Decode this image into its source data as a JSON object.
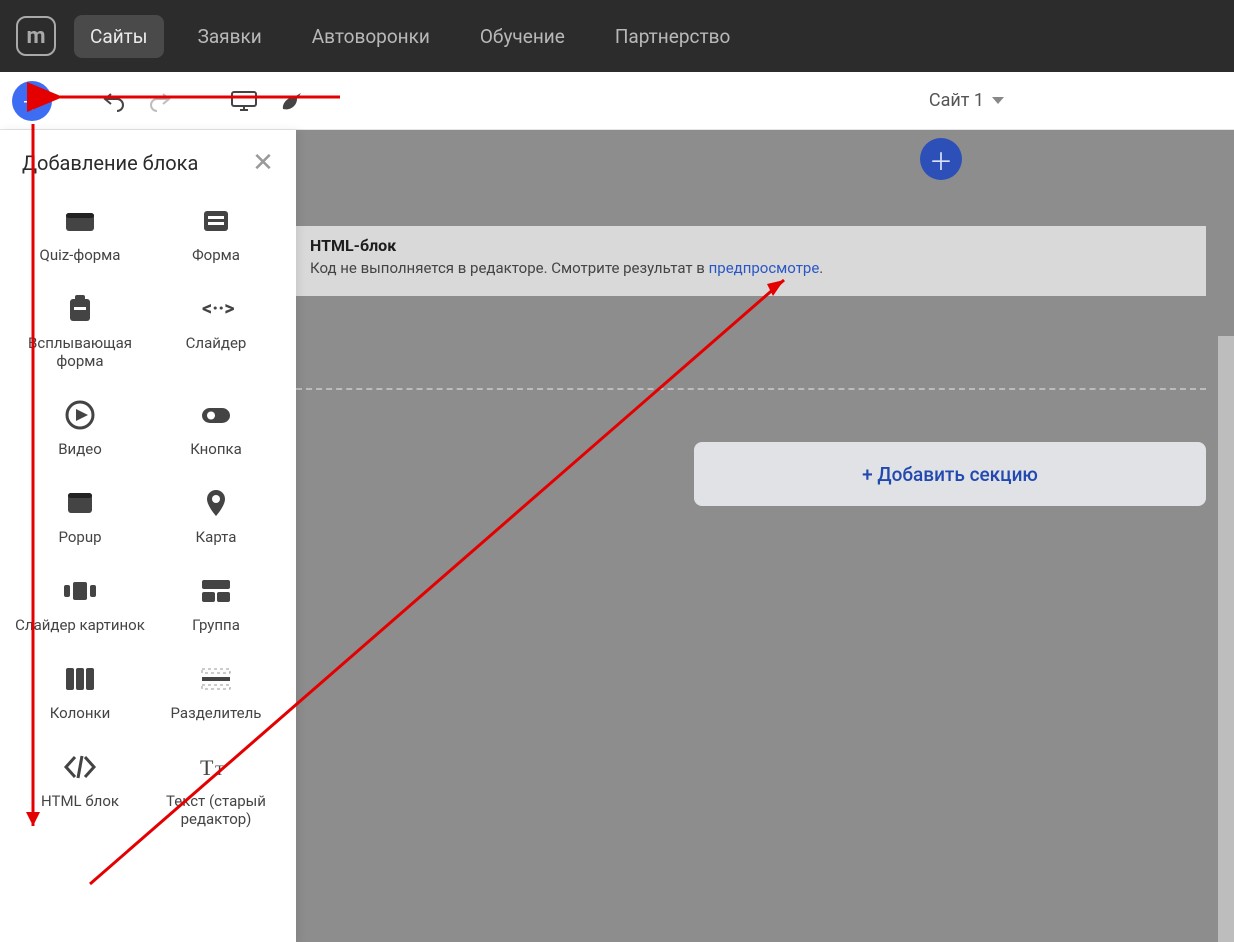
{
  "nav": {
    "items": [
      "Сайты",
      "Заявки",
      "Автоворонки",
      "Обучение",
      "Партнерство"
    ],
    "activeIndex": 0
  },
  "toolbar": {
    "siteSelector": "Сайт 1"
  },
  "panel": {
    "title": "Добавление блока",
    "blocks": [
      {
        "label": "Quiz-форма",
        "icon": "card"
      },
      {
        "label": "Форма",
        "icon": "form"
      },
      {
        "label": "Всплывающая форма",
        "icon": "clipboard"
      },
      {
        "label": "Слайдер",
        "icon": "slider"
      },
      {
        "label": "Видео",
        "icon": "play"
      },
      {
        "label": "Кнопка",
        "icon": "button"
      },
      {
        "label": "Popup",
        "icon": "popup"
      },
      {
        "label": "Карта",
        "icon": "pin"
      },
      {
        "label": "Слайдер картинок",
        "icon": "carousel"
      },
      {
        "label": "Группа",
        "icon": "group"
      },
      {
        "label": "Колонки",
        "icon": "columns"
      },
      {
        "label": "Разделитель",
        "icon": "divider"
      },
      {
        "label": "HTML блок",
        "icon": "code"
      },
      {
        "label": "Текст (старый редактор)",
        "icon": "text"
      }
    ]
  },
  "canvas": {
    "htmlBlock": {
      "title": "HTML-блок",
      "note_before": "Код не выполняется в редакторе. Смотрите результат в ",
      "note_link": "предпросмотре",
      "note_after": "."
    },
    "addSection": "+ Добавить секцию"
  }
}
